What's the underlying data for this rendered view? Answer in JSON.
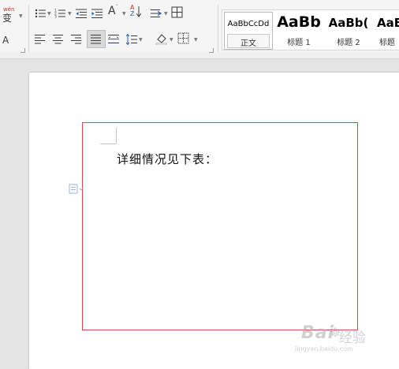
{
  "ribbon": {
    "phonetic_icon": "wén",
    "phonetic_char": "变",
    "row1_icons": [
      "bullets-icon",
      "numbering-icon",
      "decrease-indent-icon",
      "increase-indent-icon",
      "change-case-icon",
      "sort-icon",
      "line-spacing-toggle-icon",
      "borders-table-icon"
    ],
    "row2_icons": [
      "align-left-icon",
      "align-center-icon",
      "align-right-icon",
      "justify-icon",
      "distributed-icon",
      "line-spacing-icon",
      "shading-icon",
      "borders-icon"
    ],
    "styles": [
      {
        "sample": "AaBbCcDd",
        "name": "正文",
        "selected": true
      },
      {
        "sample": "AaBb",
        "name": "标题 1"
      },
      {
        "sample": "AaBb(",
        "name": "标题 2"
      },
      {
        "sample": "AaBl",
        "name": "标题"
      }
    ]
  },
  "document": {
    "body_text": "详细情况见下表：",
    "frame_color": "#e34848"
  },
  "watermark": {
    "main": "Bai",
    "paw": "☸",
    "cn": "经验",
    "url": "jingyan.baidu.com"
  }
}
